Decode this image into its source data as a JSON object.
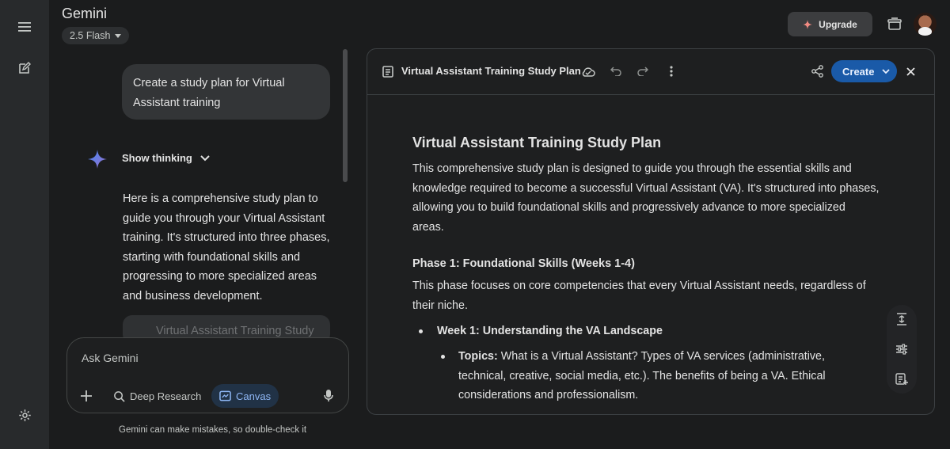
{
  "app": {
    "title": "Gemini",
    "model": "2.5 Flash"
  },
  "header": {
    "upgrade_label": "Upgrade"
  },
  "chat": {
    "user_message": "Create a study plan for Virtual Assistant training",
    "show_thinking_label": "Show thinking",
    "reply": "Here is a comprehensive study plan to guide you through your Virtual Assistant training. It's structured into three phases, starting with foundational skills and progressing to more specialized areas and business development.",
    "card_peek_title": "Virtual Assistant Training Study"
  },
  "composer": {
    "placeholder": "Ask Gemini",
    "deep_research_label": "Deep Research",
    "canvas_label": "Canvas",
    "disclaimer": "Gemini can make mistakes, so double-check it"
  },
  "canvas": {
    "title": "Virtual Assistant Training Study Plan",
    "create_label": "Create",
    "doc": {
      "heading": "Virtual Assistant Training Study Plan",
      "intro": "This comprehensive study plan is designed to guide you through the essential skills and knowledge required to become a successful Virtual Assistant (VA). It's structured into phases, allowing you to build foundational skills and progressively advance to more specialized areas.",
      "phase1_heading": "Phase 1: Foundational Skills (Weeks 1-4)",
      "phase1_text": "This phase focuses on core competencies that every Virtual Assistant needs, regardless of their niche.",
      "week1_heading": "Week 1: Understanding the VA Landscape",
      "topics_label": "Topics:",
      "topics_text": "What is a Virtual Assistant? Types of VA services (administrative, technical, creative, social media, etc.). The benefits of being a VA. Ethical considerations and professionalism."
    }
  },
  "colors": {
    "accent": "#1a5aa8",
    "canvas_chip": "#8fb7f5",
    "background": "#1b1c1d"
  }
}
